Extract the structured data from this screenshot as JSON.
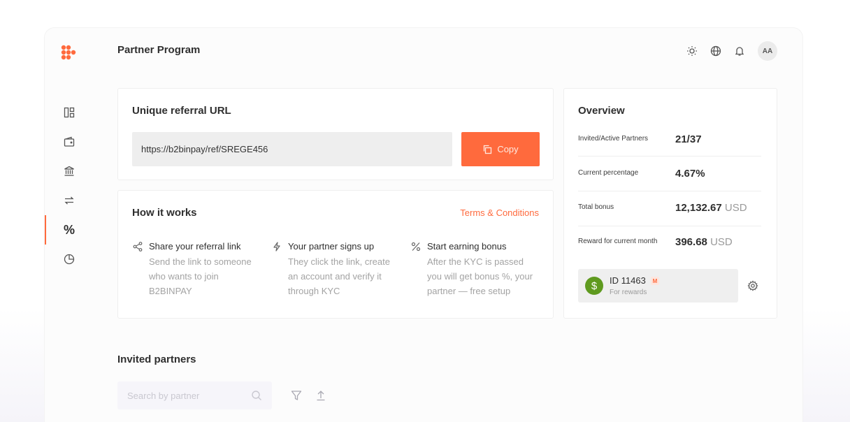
{
  "header": {
    "title": "Partner Program",
    "avatar_initials": "AA",
    "icons": [
      "sun-icon",
      "globe-icon",
      "bell-icon"
    ]
  },
  "sidebar": {
    "items": [
      {
        "icon": "dashboard-icon",
        "active": false
      },
      {
        "icon": "wallet-icon",
        "active": false
      },
      {
        "icon": "bank-icon",
        "active": false
      },
      {
        "icon": "exchange-icon",
        "active": false
      },
      {
        "icon": "percent-icon",
        "glyph": "%",
        "active": true
      },
      {
        "icon": "pie-chart-icon",
        "active": false
      }
    ]
  },
  "referral": {
    "title": "Unique referral URL",
    "url": "https://b2binpay/ref/SREGE456",
    "copy_label": "Copy"
  },
  "how_it_works": {
    "title": "How it works",
    "terms_label": "Terms & Conditions",
    "steps": [
      {
        "icon": "share-icon",
        "title": "Share your referral link",
        "desc": "Send the link to someone who wants to join B2BINPAY"
      },
      {
        "icon": "lightning-icon",
        "title": "Your partner signs up",
        "desc": "They click the link, create an account and verify it through KYC"
      },
      {
        "icon": "percent-icon",
        "title": "Start earning bonus",
        "desc": "After the KYC is passed you will get bonus %, your partner — free setup"
      }
    ]
  },
  "overview": {
    "title": "Overview",
    "rows": [
      {
        "label": "Invited/Active Partners",
        "value": "21/37",
        "unit": ""
      },
      {
        "label": "Current percentage",
        "value": "4.67%",
        "unit": ""
      },
      {
        "label": "Total bonus",
        "value": "12,132.67",
        "unit": "USD"
      },
      {
        "label": "Reward for current month",
        "value": "396.68",
        "unit": "USD"
      }
    ],
    "account": {
      "symbol": "$",
      "id_label": "ID 11463",
      "badge": "M",
      "sub_label": "For rewards"
    }
  },
  "invited": {
    "title": "Invited partners",
    "search_placeholder": "Search by partner"
  },
  "colors": {
    "accent": "#ff6a3d",
    "wallet_green": "#5f9a1f"
  }
}
